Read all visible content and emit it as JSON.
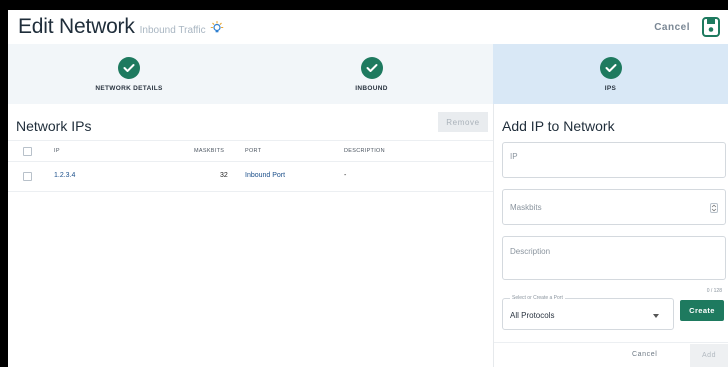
{
  "header": {
    "title": "Edit Network",
    "subtitle": "Inbound Traffic",
    "cancel_label": "Cancel"
  },
  "stepper": {
    "steps": [
      {
        "label": "NETWORK DETAILS",
        "complete": true
      },
      {
        "label": "INBOUND",
        "complete": true
      },
      {
        "label": "IPS",
        "complete": true,
        "active": true
      }
    ]
  },
  "network_ips": {
    "title": "Network IPs",
    "remove_label": "Remove",
    "columns": [
      "IP",
      "MASKBITS",
      "PORT",
      "DESCRIPTION"
    ],
    "rows": [
      {
        "ip": "1.2.3.4",
        "maskbits": "32",
        "port": "Inbound Port",
        "description": "-"
      }
    ]
  },
  "add_ip": {
    "title": "Add IP to Network",
    "ip_placeholder": "IP",
    "maskbits_placeholder": "Maskbits",
    "description_placeholder": "Description",
    "description_counter": "0 / 128",
    "port_legend": "Select or Create a Port",
    "port_value": "All Protocols",
    "create_label": "Create",
    "cancel_label": "Cancel",
    "add_label": "Add"
  },
  "colors": {
    "accent": "#1e7a5f",
    "active_step_bg": "#d9e8f6",
    "link": "#1b4f8a"
  }
}
